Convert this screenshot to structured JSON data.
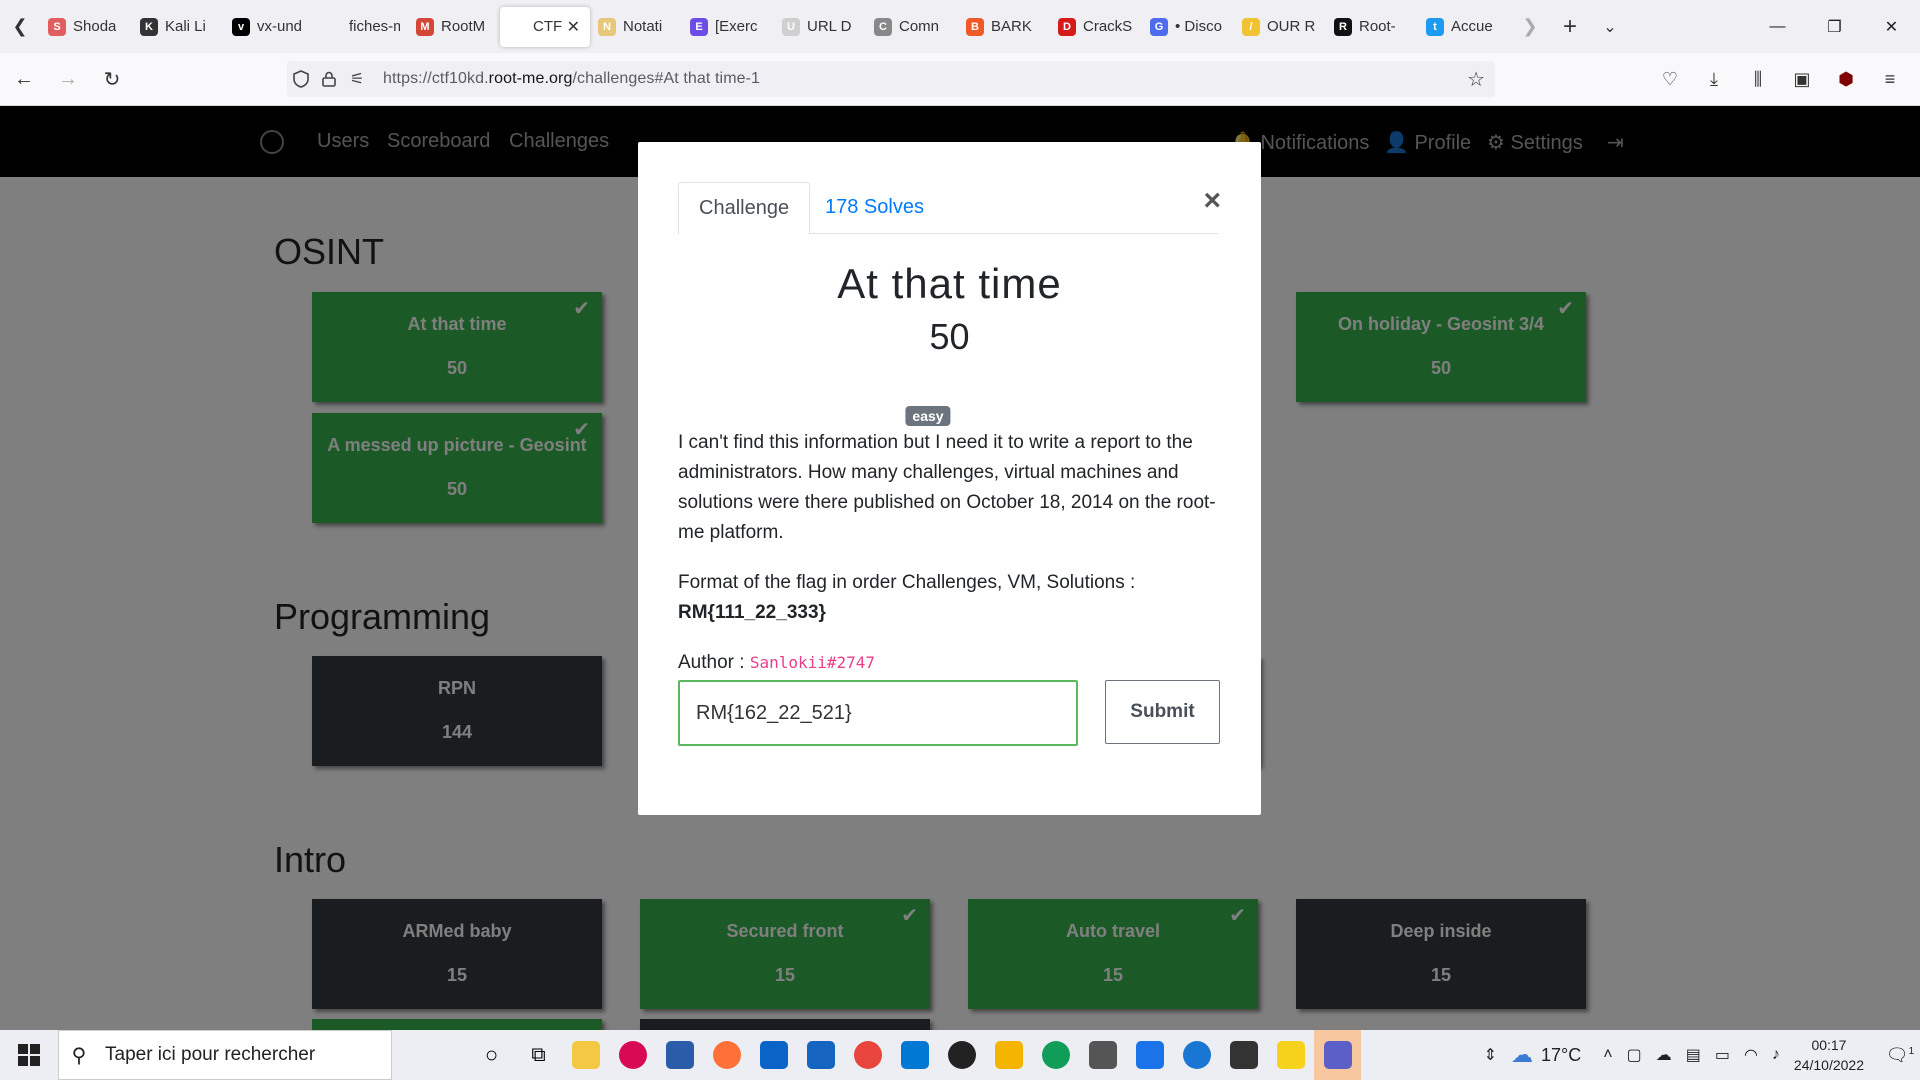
{
  "browser": {
    "tabs": [
      {
        "label": "Shoda",
        "color": "#e25d5d",
        "glyph": "S"
      },
      {
        "label": "Kali Li",
        "color": "#333333",
        "glyph": "K"
      },
      {
        "label": "vx-und",
        "color": "#000000",
        "glyph": "v"
      },
      {
        "label": "fiches-me",
        "color": "#f0f0f4",
        "glyph": ""
      },
      {
        "label": "RootM",
        "color": "#d44638",
        "glyph": "M"
      },
      {
        "label": "CTF",
        "color": "#ffffff",
        "glyph": "",
        "active": true
      },
      {
        "label": "Notati",
        "color": "#e8c77a",
        "glyph": "N"
      },
      {
        "label": "[Exerc",
        "color": "#6c4ee6",
        "glyph": "E"
      },
      {
        "label": "URL D",
        "color": "#cfcfcf",
        "glyph": "U"
      },
      {
        "label": "Comn",
        "color": "#888888",
        "glyph": "C"
      },
      {
        "label": "BARK",
        "color": "#f05a28",
        "glyph": "B"
      },
      {
        "label": "CrackS",
        "color": "#d61a1a",
        "glyph": "D"
      },
      {
        "label": "• Disco",
        "color": "#4f6bf0",
        "glyph": "G"
      },
      {
        "label": "OUR R",
        "color": "#f1c232",
        "glyph": "/"
      },
      {
        "label": "Root-",
        "color": "#111111",
        "glyph": "R"
      },
      {
        "label": "Accue",
        "color": "#1d9bf0",
        "glyph": "t"
      }
    ],
    "url_prefix": "https://ctf10kd.",
    "url_domain": "root-me.org",
    "url_suffix": "/challenges#At that time-1"
  },
  "site_nav": {
    "links": [
      "Users",
      "Scoreboard",
      "Challenges"
    ],
    "right": [
      "Notifications",
      "Profile",
      "Settings"
    ]
  },
  "sections": [
    {
      "title": "OSINT"
    },
    {
      "title": "Programming"
    },
    {
      "title": "Intro"
    }
  ],
  "cards": {
    "osint": [
      {
        "name": "At that time",
        "value": "50",
        "solved": true
      },
      {
        "name": "On holiday - Geosint 3/4",
        "value": "50",
        "solved": true
      },
      {
        "name": "A messed up picture - Geosint",
        "value": "50",
        "solved": true
      }
    ],
    "programming": [
      {
        "name": "RPN",
        "value": "144",
        "solved": false
      }
    ],
    "intro": [
      {
        "name": "ARMed baby",
        "value": "15",
        "solved": false
      },
      {
        "name": "Secured front",
        "value": "15",
        "solved": true
      },
      {
        "name": "Auto travel",
        "value": "15",
        "solved": true
      },
      {
        "name": "Deep inside",
        "value": "15",
        "solved": false
      }
    ]
  },
  "modal": {
    "tab_challenge": "Challenge",
    "tab_solves": "178 Solves",
    "close": "×",
    "title": "At that time",
    "value": "50",
    "difficulty": "easy",
    "description": "I can't find this information but I need it to write a report to the administrators. How many challenges, virtual machines and solutions were there published on October 18, 2014 on the root-me platform.",
    "format_text": "Format of the flag in order Challenges, VM, Solutions :",
    "format_example": "RM{111_22_333}",
    "author_label": "Author :",
    "author_name": "Sanlokii#2747",
    "input_value": "RM{162_22_521}",
    "submit_label": "Submit"
  },
  "taskbar": {
    "search_placeholder": "Taper ici pour rechercher",
    "weather": "17°C",
    "time": "00:17",
    "date": "24/10/2022",
    "notifications_count": "1"
  },
  "colors": {
    "solved": "#37b24d",
    "unsolved": "#343a40",
    "link": "#007bff",
    "input_border": "#5cb85c"
  }
}
